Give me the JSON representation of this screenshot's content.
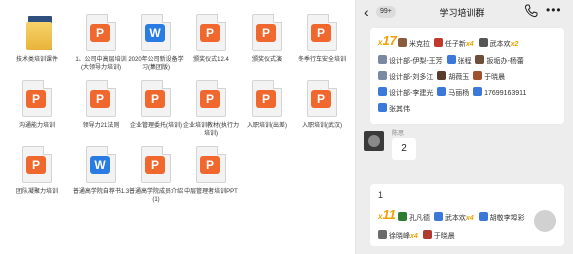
{
  "files": [
    {
      "type": "folder",
      "name": "技术类培训课件"
    },
    {
      "type": "ppt",
      "name": "1、公司中高层培训(大领导力培训)"
    },
    {
      "type": "doc",
      "name": "2020年公司新设备学习(集团版)"
    },
    {
      "type": "ppt",
      "name": "颁奖仪式12.4"
    },
    {
      "type": "ppt",
      "name": "颁奖仪式演"
    },
    {
      "type": "ppt",
      "name": "冬季行车安全培训"
    },
    {
      "type": "ppt",
      "name": "沟通能力培训"
    },
    {
      "type": "ppt",
      "name": "领导力21法则"
    },
    {
      "type": "ppt",
      "name": "企业管理委托(培训)"
    },
    {
      "type": "ppt",
      "name": "企业培训教材(执行力培训)"
    },
    {
      "type": "ppt",
      "name": "入职培训(出差)"
    },
    {
      "type": "ppt",
      "name": "入职培训(武汉)"
    },
    {
      "type": "ppt",
      "name": "团队凝聚力培训"
    },
    {
      "type": "doc",
      "name": "普通高学院自荐书1.3"
    },
    {
      "type": "ppt",
      "name": "普通高学院成员介绍(1)"
    },
    {
      "type": "ppt",
      "name": "中层管理者培训PPT"
    }
  ],
  "file_badges": {
    "ppt": "P",
    "doc": "W"
  },
  "chat": {
    "back_icon": "chevron-left-icon",
    "unread_count": "99+",
    "title": "学习培训群",
    "call_icon": "phone-icon",
    "more_label": "•••",
    "card1": {
      "multiplier": "17",
      "line1": [
        {
          "name": "米克拉",
          "mult": ""
        },
        {
          "name": "任子新",
          "mult": "x4"
        },
        {
          "name": "武本欢",
          "mult": "x2"
        }
      ],
      "line2": [
        "设计部-伊梨-王芳",
        "张程",
        "扳垢办-杨蕾"
      ],
      "line3": [
        "设计部-刘多江",
        "胡薇玉",
        "于晓晨"
      ],
      "line4": [
        "设计部-李建光",
        "马丽杨",
        "17699163911"
      ],
      "line5": [
        "张其伟"
      ]
    },
    "msg2": {
      "sender": "陈思",
      "text": "2"
    },
    "card3": {
      "text": "1",
      "multiplier": "11",
      "line1": [
        {
          "name": "孔凡德",
          "mult": ""
        },
        {
          "name": "武本欢",
          "mult": "x4"
        },
        {
          "name": "胡敬李埠彩",
          "mult": ""
        }
      ],
      "line2": [
        {
          "name": "徐晓峰",
          "mult": "x4"
        },
        {
          "name": "于晓晨",
          "mult": ""
        }
      ]
    }
  },
  "colors": {
    "ppt": "#f0682d",
    "doc": "#2b7be5",
    "accent": "#f0a000",
    "panel": "#ededed"
  }
}
